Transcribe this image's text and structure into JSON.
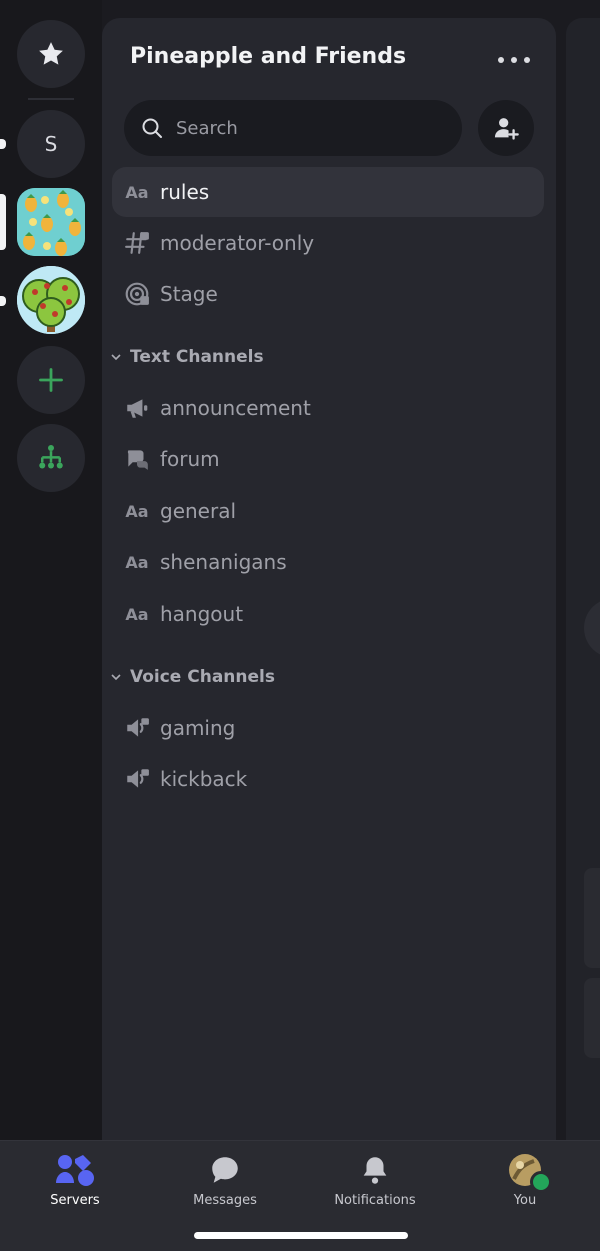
{
  "server": {
    "name": "Pineapple and Friends",
    "search_placeholder": "Search"
  },
  "rail": {
    "items": [
      {
        "icon": "star-icon"
      },
      {
        "letter": "S"
      },
      {
        "icon": "pineapple-server-icon"
      },
      {
        "icon": "tree-server-icon"
      },
      {
        "icon": "plus-icon"
      },
      {
        "icon": "hierarchy-icon"
      }
    ]
  },
  "channels": {
    "top": [
      {
        "label": "rules",
        "icon": "Aa",
        "active": true
      },
      {
        "label": "moderator-only",
        "icon": "hash-lock-icon"
      },
      {
        "label": "Stage",
        "icon": "stage-icon"
      }
    ],
    "categories": [
      {
        "label": "Text Channels",
        "items": [
          {
            "label": "announcement",
            "icon": "megaphone-icon"
          },
          {
            "label": "forum",
            "icon": "forum-icon"
          },
          {
            "label": "general",
            "icon": "Aa"
          },
          {
            "label": "shenanigans",
            "icon": "Aa"
          },
          {
            "label": "hangout",
            "icon": "Aa"
          }
        ]
      },
      {
        "label": "Voice Channels",
        "items": [
          {
            "label": "gaming",
            "icon": "speaker-lock-icon"
          },
          {
            "label": "kickback",
            "icon": "speaker-lock-icon"
          }
        ]
      }
    ]
  },
  "nav": {
    "items": [
      {
        "label": "Servers",
        "active": true
      },
      {
        "label": "Messages"
      },
      {
        "label": "Notifications"
      },
      {
        "label": "You"
      }
    ]
  },
  "colors": {
    "accent": "#5865f2",
    "add_green": "#3ba55c",
    "status_online": "#23a55a"
  }
}
